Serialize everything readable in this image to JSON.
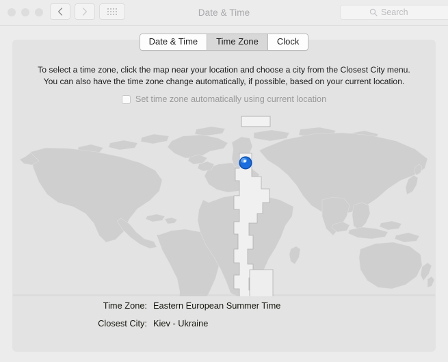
{
  "window": {
    "title": "Date & Time",
    "traffic_lights": [
      "close",
      "minimize",
      "zoom"
    ],
    "nav": {
      "back_icon": "chevron-left-icon",
      "forward_icon": "chevron-right-icon",
      "show_all_icon": "grid-dots-icon"
    },
    "search": {
      "placeholder": "Search",
      "icon": "search-icon",
      "value": ""
    }
  },
  "tabs": [
    {
      "label": "Date & Time",
      "selected": false
    },
    {
      "label": "Time Zone",
      "selected": true
    },
    {
      "label": "Clock",
      "selected": false
    }
  ],
  "instructions": {
    "line1": "To select a time zone, click the map near your location and choose a city from the Closest City menu.",
    "line2": "You can also have the time zone change automatically, if possible, based on your current location."
  },
  "auto_timezone": {
    "label": "Set time zone automatically using current location",
    "checked": false,
    "enabled": false
  },
  "map": {
    "marker_icon": "location-marker-icon",
    "marker_color": "#1a6fe0",
    "selected_zone_fill": "#f0f0f0",
    "land_color": "#cfcfcf",
    "ocean_color": "#e3e3e3"
  },
  "details": [
    {
      "label": "Time Zone:",
      "value": "Eastern European Summer Time"
    },
    {
      "label": "Closest City:",
      "value": "Kiev - Ukraine"
    }
  ],
  "colors": {
    "window_bg": "#ececec",
    "panel_bg": "#e3e3e3",
    "tab_selected_bg": "#d8d8d8",
    "text": "#1d1d1d",
    "muted_text": "#9a9a9a",
    "title_text": "#a8a8ac"
  }
}
